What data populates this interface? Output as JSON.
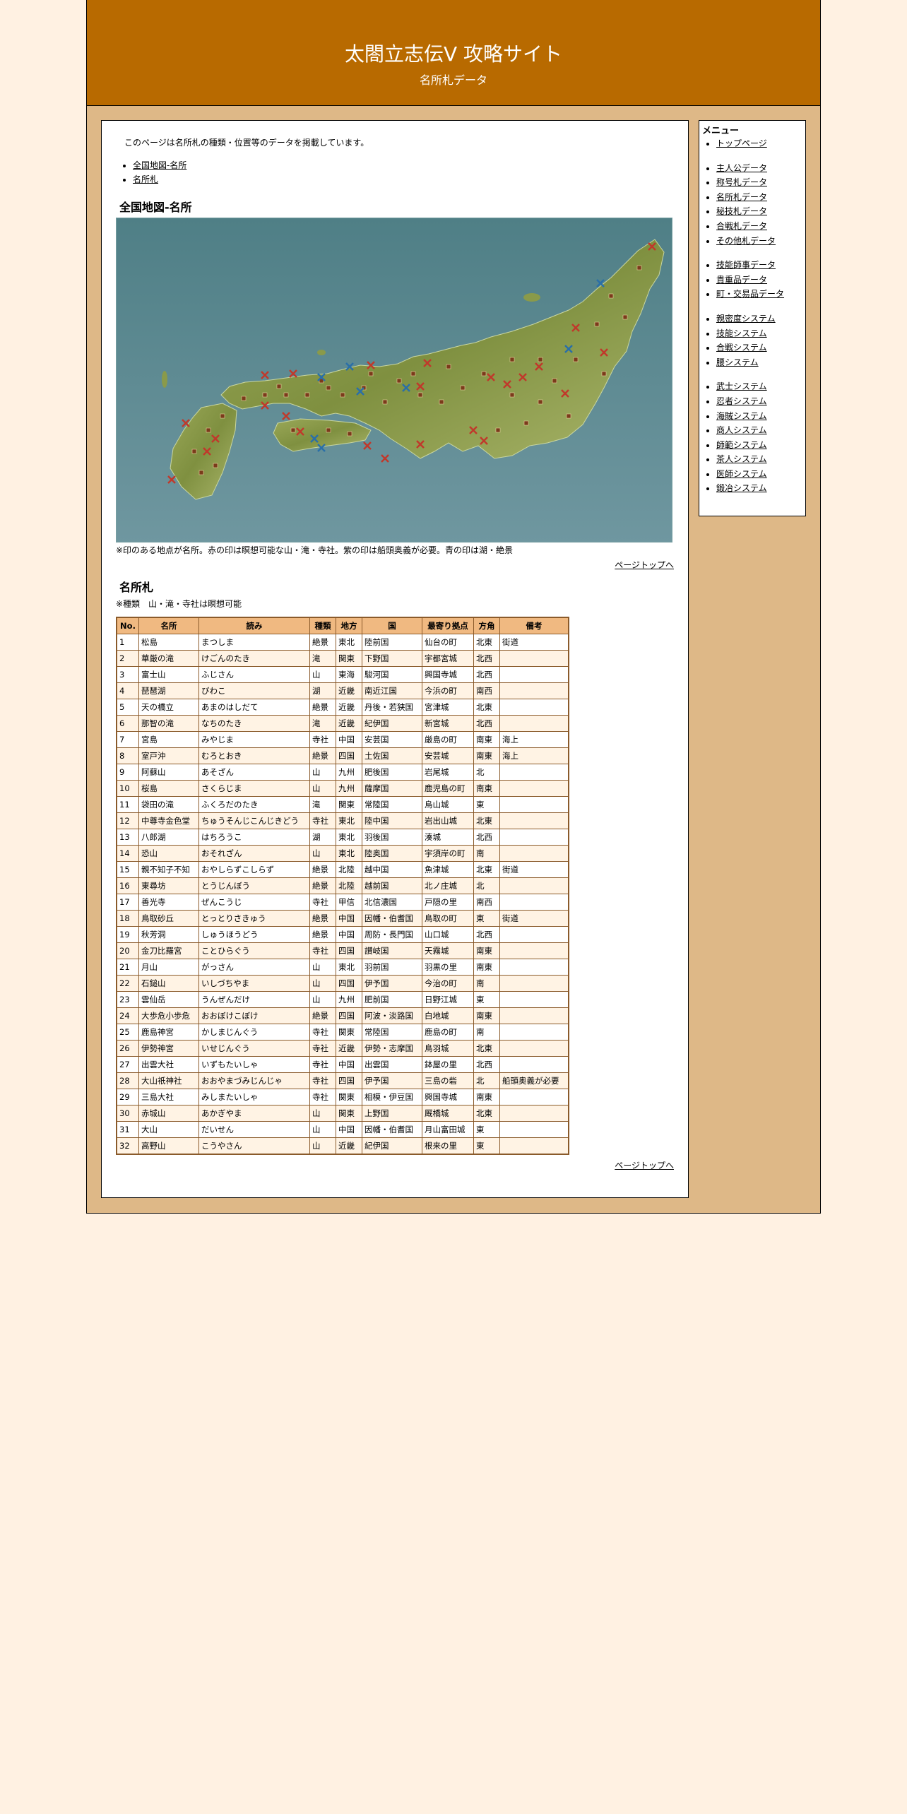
{
  "header": {
    "title": "太閤立志伝V 攻略サイト",
    "subtitle": "名所札データ"
  },
  "intro": "このページは名所札の種類・位置等のデータを掲載しています。",
  "toc": [
    "全国地図-名所",
    "名所札"
  ],
  "map_section": {
    "heading": "全国地図-名所",
    "note": "※印のある地点が名所。赤の印は瞑想可能な山・滝・寺社。紫の印は船頭奥義が必要。青の印は湖・絶景",
    "sea_color": "#5a8a92",
    "land_color": "#8a9a4a",
    "red_mark": "#c0392b",
    "blue_mark": "#2a6fa8"
  },
  "table_section": {
    "heading": "名所札",
    "note": "※種類　山・滝・寺社は瞑想可能",
    "columns": [
      "No.",
      "名所",
      "読み",
      "種類",
      "地方",
      "国",
      "最寄り拠点",
      "方角",
      "備考"
    ],
    "rows": [
      [
        "1",
        "松島",
        "まつしま",
        "絶景",
        "東北",
        "陸前国",
        "仙台の町",
        "北東",
        "街道"
      ],
      [
        "2",
        "華厳の滝",
        "けごんのたき",
        "滝",
        "関東",
        "下野国",
        "宇都宮城",
        "北西",
        ""
      ],
      [
        "3",
        "富士山",
        "ふじさん",
        "山",
        "東海",
        "駿河国",
        "興国寺城",
        "北西",
        ""
      ],
      [
        "4",
        "琵琶湖",
        "びわこ",
        "湖",
        "近畿",
        "南近江国",
        "今浜の町",
        "南西",
        ""
      ],
      [
        "5",
        "天の橋立",
        "あまのはしだて",
        "絶景",
        "近畿",
        "丹後・若狭国",
        "宮津城",
        "北東",
        ""
      ],
      [
        "6",
        "那智の滝",
        "なちのたき",
        "滝",
        "近畿",
        "紀伊国",
        "新宮城",
        "北西",
        ""
      ],
      [
        "7",
        "宮島",
        "みやじま",
        "寺社",
        "中国",
        "安芸国",
        "厳島の町",
        "南東",
        "海上"
      ],
      [
        "8",
        "室戸沖",
        "むろとおき",
        "絶景",
        "四国",
        "土佐国",
        "安芸城",
        "南東",
        "海上"
      ],
      [
        "9",
        "阿蘇山",
        "あそざん",
        "山",
        "九州",
        "肥後国",
        "岩尾城",
        "北",
        ""
      ],
      [
        "10",
        "桜島",
        "さくらじま",
        "山",
        "九州",
        "薩摩国",
        "鹿児島の町",
        "南東",
        ""
      ],
      [
        "11",
        "袋田の滝",
        "ふくろだのたき",
        "滝",
        "関東",
        "常陸国",
        "烏山城",
        "東",
        ""
      ],
      [
        "12",
        "中尊寺金色堂",
        "ちゅうそんじこんじきどう",
        "寺社",
        "東北",
        "陸中国",
        "岩出山城",
        "北東",
        ""
      ],
      [
        "13",
        "八郎湖",
        "はちろうこ",
        "湖",
        "東北",
        "羽後国",
        "湊城",
        "北西",
        ""
      ],
      [
        "14",
        "恐山",
        "おそれざん",
        "山",
        "東北",
        "陸奥国",
        "宇須岸の町",
        "南",
        ""
      ],
      [
        "15",
        "親不知子不知",
        "おやしらずこしらず",
        "絶景",
        "北陸",
        "越中国",
        "魚津城",
        "北東",
        "街道"
      ],
      [
        "16",
        "東尋坊",
        "とうじんぼう",
        "絶景",
        "北陸",
        "越前国",
        "北ノ庄城",
        "北",
        ""
      ],
      [
        "17",
        "善光寺",
        "ぜんこうじ",
        "寺社",
        "甲信",
        "北信濃国",
        "戸隠の里",
        "南西",
        ""
      ],
      [
        "18",
        "鳥取砂丘",
        "とっとりさきゅう",
        "絶景",
        "中国",
        "因幡・伯耆国",
        "鳥取の町",
        "東",
        "街道"
      ],
      [
        "19",
        "秋芳洞",
        "しゅうほうどう",
        "絶景",
        "中国",
        "周防・長門国",
        "山口城",
        "北西",
        ""
      ],
      [
        "20",
        "金刀比羅宮",
        "ことひらぐう",
        "寺社",
        "四国",
        "讃岐国",
        "天霧城",
        "南東",
        ""
      ],
      [
        "21",
        "月山",
        "がっさん",
        "山",
        "東北",
        "羽前国",
        "羽黒の里",
        "南東",
        ""
      ],
      [
        "22",
        "石鎚山",
        "いしづちやま",
        "山",
        "四国",
        "伊予国",
        "今治の町",
        "南",
        ""
      ],
      [
        "23",
        "雲仙岳",
        "うんぜんだけ",
        "山",
        "九州",
        "肥前国",
        "日野江城",
        "東",
        ""
      ],
      [
        "24",
        "大歩危小歩危",
        "おおぼけこぼけ",
        "絶景",
        "四国",
        "阿波・淡路国",
        "白地城",
        "南東",
        ""
      ],
      [
        "25",
        "鹿島神宮",
        "かしまじんぐう",
        "寺社",
        "関東",
        "常陸国",
        "鹿島の町",
        "南",
        ""
      ],
      [
        "26",
        "伊勢神宮",
        "いせじんぐう",
        "寺社",
        "近畿",
        "伊勢・志摩国",
        "鳥羽城",
        "北東",
        ""
      ],
      [
        "27",
        "出雲大社",
        "いずもたいしゃ",
        "寺社",
        "中国",
        "出雲国",
        "鉢屋の里",
        "北西",
        ""
      ],
      [
        "28",
        "大山祇神社",
        "おおやまづみじんじゃ",
        "寺社",
        "四国",
        "伊予国",
        "三島の砦",
        "北",
        "船頭奥義が必要"
      ],
      [
        "29",
        "三島大社",
        "みしまたいしゃ",
        "寺社",
        "関東",
        "相模・伊豆国",
        "興国寺城",
        "南東",
        ""
      ],
      [
        "30",
        "赤城山",
        "あかぎやま",
        "山",
        "関東",
        "上野国",
        "厩橋城",
        "北東",
        ""
      ],
      [
        "31",
        "大山",
        "だいせん",
        "山",
        "中国",
        "因幡・伯耆国",
        "月山富田城",
        "東",
        ""
      ],
      [
        "32",
        "高野山",
        "こうやさん",
        "山",
        "近畿",
        "紀伊国",
        "根来の里",
        "東",
        ""
      ]
    ]
  },
  "page_top": "ページトップへ",
  "menu": {
    "title": "メニュー",
    "groups": [
      [
        "トップページ"
      ],
      [
        "主人公データ",
        "称号札データ",
        "名所札データ",
        "秘技札データ",
        "合戦札データ",
        "その他札データ"
      ],
      [
        "技能師事データ",
        "貴重品データ",
        "町・交易品データ"
      ],
      [
        "親密度システム",
        "技能システム",
        "合戦システム",
        "腰システム"
      ],
      [
        "武士システム",
        "忍者システム",
        "海賊システム",
        "商人システム",
        "師範システム",
        "茶人システム",
        "医師システム",
        "鍛冶システム"
      ]
    ]
  }
}
